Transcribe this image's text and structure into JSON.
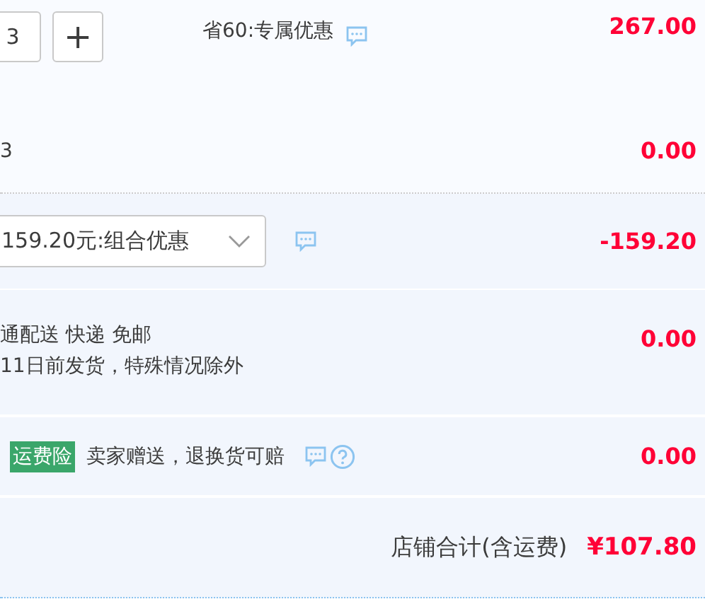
{
  "quantity": {
    "value": "3",
    "plus": "+"
  },
  "promo": {
    "text": "省60:专属优惠"
  },
  "item_price": "267.00",
  "item_count": "3",
  "item_extra": "0.00",
  "combo": {
    "selected_text": "159.20元:组合优惠",
    "amount": "-159.20"
  },
  "delivery": {
    "lines": [
      "通配送 快递 免邮",
      "11日前发货，特殊情况除外"
    ],
    "amount": "0.00"
  },
  "insurance": {
    "tag": "运费险",
    "text": "卖家赠送，退换货可赔",
    "amount": "0.00"
  },
  "total": {
    "label": "店铺合计(含运费)",
    "amount": "¥107.80"
  }
}
